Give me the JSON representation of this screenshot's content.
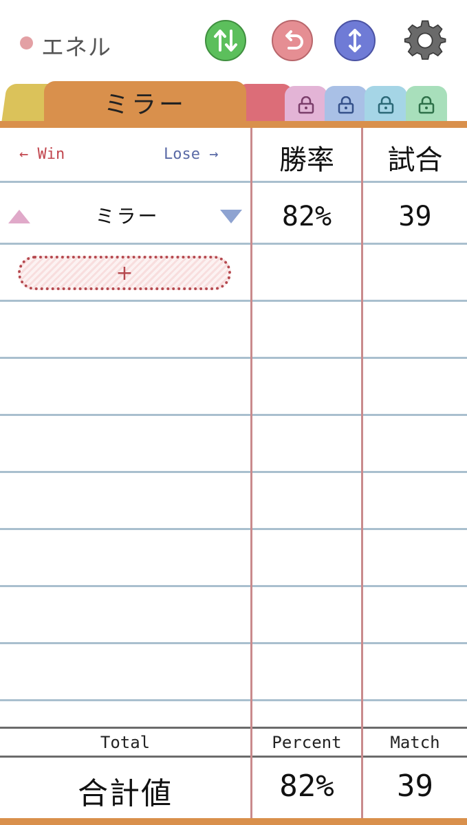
{
  "header": {
    "deck_name": "エネル",
    "deck_dot_color": "#e3a0a4"
  },
  "toolbar": {
    "buttons": [
      {
        "name": "sort-icon",
        "color": "#4fae4f"
      },
      {
        "name": "undo-icon",
        "color": "#d97a80"
      },
      {
        "name": "expand-icon",
        "color": "#5f69c5"
      },
      {
        "name": "gear-icon",
        "color": "#555555"
      }
    ]
  },
  "tabs": {
    "active_label": "ミラー",
    "colors": [
      "#dbc25a",
      "#d9904c",
      "#dc6d78",
      "#e3b4d6",
      "#a9c0e6",
      "#a5d5e6",
      "#a8dfbb"
    ]
  },
  "table": {
    "win_hint": "← Win",
    "lose_hint": "Lose →",
    "col_rate": "勝率",
    "col_match": "試合",
    "rows": [
      {
        "name": "ミラー",
        "rate": "82%",
        "matches": "39"
      }
    ],
    "add_label": "+"
  },
  "footer": {
    "total_label": "Total",
    "percent_label": "Percent",
    "match_label": "Match",
    "sum_label": "合計値",
    "total_rate": "82%",
    "total_matches": "39"
  }
}
